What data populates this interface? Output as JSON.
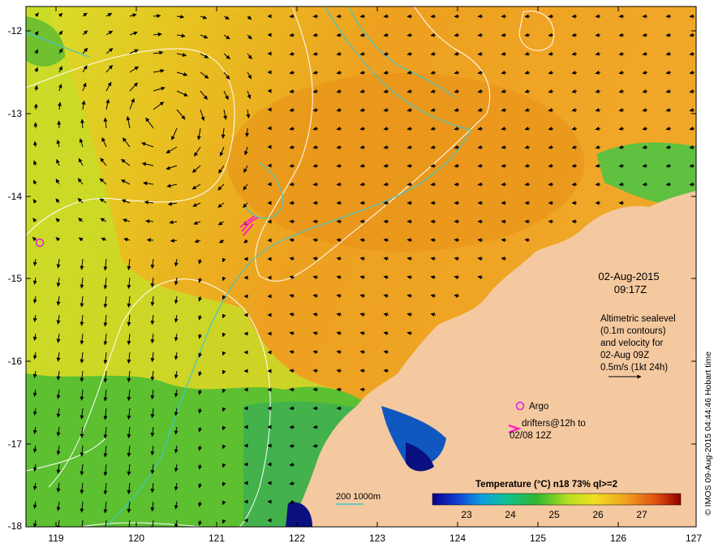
{
  "map": {
    "lon_ticks": [
      "119",
      "120",
      "121",
      "122",
      "123",
      "124",
      "125",
      "126",
      "127"
    ],
    "lat_ticks": [
      "-12",
      "-13",
      "-14",
      "-15",
      "-16",
      "-17",
      "-18"
    ]
  },
  "annotations": {
    "date": "02-Aug-2015",
    "time": "09:17Z",
    "altimetry_lines": [
      "Altimetric sealevel",
      "(0.1m contours)",
      "and velocity for",
      "02-Aug 09Z",
      "0.5m/s (1kt 24h)"
    ],
    "argo_label": "Argo",
    "drifters_line1": "drifters@12h to",
    "drifters_line2": "02/08 12Z",
    "depth_legend": "200  1000m",
    "credit": "© IMOS 09-Aug-2015 04:44:46 Hobart time"
  },
  "colorbar": {
    "title": "Temperature (°C) n18 73% ql>=2",
    "ticks": [
      "23",
      "24",
      "25",
      "26",
      "27"
    ]
  },
  "colors": {
    "land": "#f5c9a0",
    "argo": "#e020e0",
    "drifter": "#ff20c0",
    "isobath": "#40c8c8",
    "contour": "#ffffff"
  }
}
